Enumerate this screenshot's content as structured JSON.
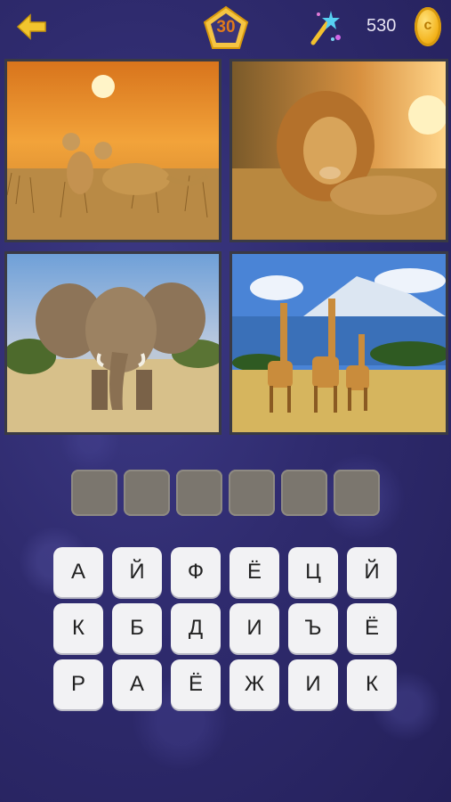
{
  "header": {
    "level": "30",
    "coins": "530",
    "coin_symbol": "c",
    "back_icon": "back-arrow-icon",
    "hint_icon": "magic-wand-icon"
  },
  "answer": {
    "slots": [
      "",
      "",
      "",
      "",
      "",
      ""
    ]
  },
  "keyboard": {
    "rows": [
      [
        "А",
        "Й",
        "Ф",
        "Ё",
        "Ц",
        "Й"
      ],
      [
        "К",
        "Б",
        "Д",
        "И",
        "Ъ",
        "Ё"
      ],
      [
        "Р",
        "А",
        "Ё",
        "Ж",
        "И",
        "К"
      ]
    ]
  },
  "colors": {
    "background": "#2f2b6e",
    "accent": "#f3b31c",
    "slot": "#7b766e",
    "key": "#f2f2f4"
  }
}
